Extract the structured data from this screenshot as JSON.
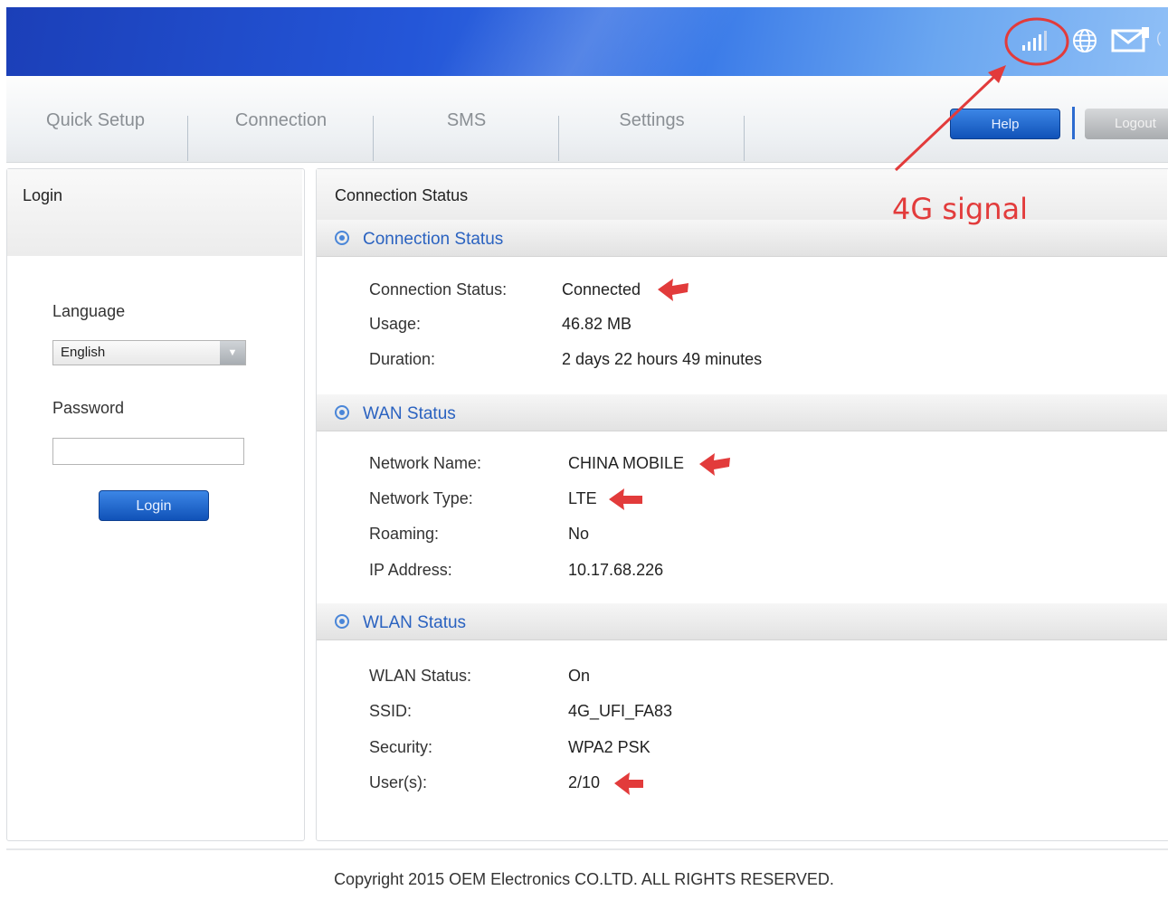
{
  "nav": {
    "tabs": [
      "Quick Setup",
      "Connection",
      "SMS",
      "Settings"
    ],
    "help_label": "Help",
    "logout_label": "Logout"
  },
  "header_icons": [
    "signal-bars-icon",
    "globe-icon",
    "mail-icon"
  ],
  "login_panel": {
    "title": "Login",
    "language_label": "Language",
    "language_value": "English",
    "password_label": "Password",
    "password_value": "",
    "login_button": "Login"
  },
  "main": {
    "title": "Connection Status",
    "sections": {
      "connection": {
        "title": "Connection Status",
        "rows": [
          {
            "label": "Connection Status:",
            "value": "Connected"
          },
          {
            "label": "Usage:",
            "value": "46.82 MB"
          },
          {
            "label": "Duration:",
            "value": "2 days 22 hours 49 minutes"
          }
        ]
      },
      "wan": {
        "title": "WAN Status",
        "rows": [
          {
            "label": "Network Name:",
            "value": "CHINA MOBILE"
          },
          {
            "label": "Network Type:",
            "value": "LTE"
          },
          {
            "label": "Roaming:",
            "value": "No"
          },
          {
            "label": "IP Address:",
            "value": "10.17.68.226"
          }
        ]
      },
      "wlan": {
        "title": "WLAN Status",
        "rows": [
          {
            "label": "WLAN Status:",
            "value": "On"
          },
          {
            "label": "SSID:",
            "value": "4G_UFI_FA83"
          },
          {
            "label": "Security:",
            "value": "WPA2 PSK"
          },
          {
            "label": "User(s):",
            "value": "2/10"
          }
        ]
      }
    }
  },
  "annotation": {
    "label": "4G signal",
    "color": "#e23b3b"
  },
  "footer": {
    "copyright": "Copyright 2015 OEM Electronics CO.LTD. ALL RIGHTS RESERVED."
  }
}
